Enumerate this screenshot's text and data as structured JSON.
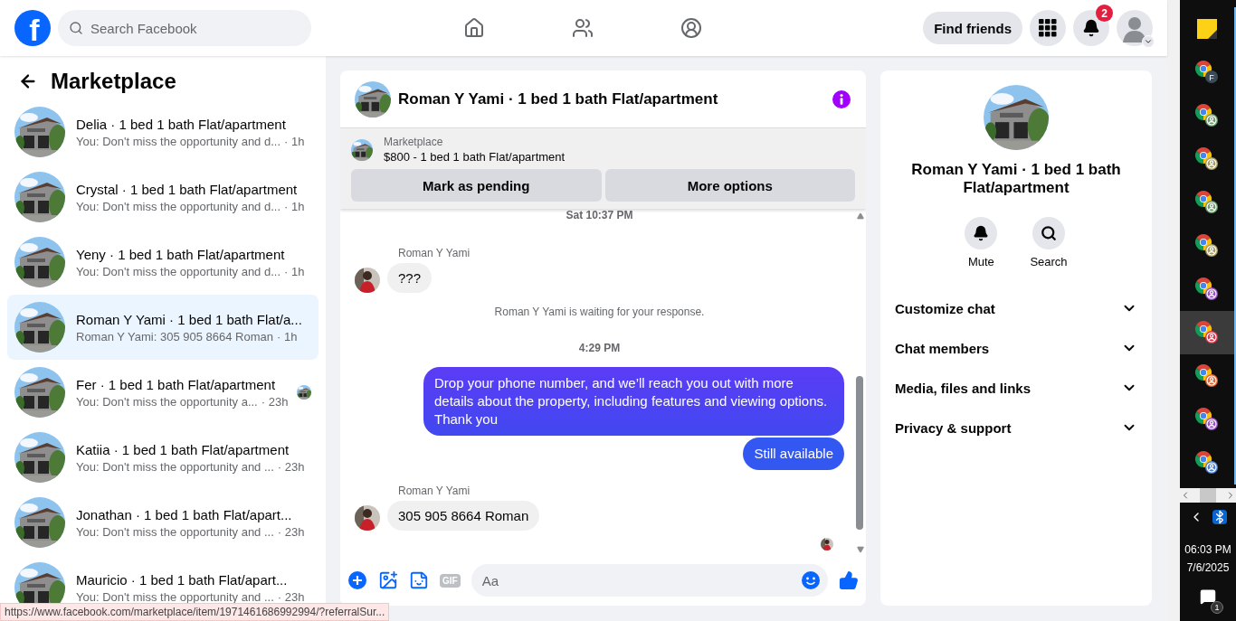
{
  "topbar": {
    "logo": "f",
    "search": {
      "placeholder": "Search Facebook"
    },
    "nav": [
      {
        "kind": "home",
        "selected": false
      },
      {
        "kind": "friends",
        "selected": false
      },
      {
        "kind": "groups",
        "selected": false
      }
    ],
    "find_friends": "Find friends",
    "notifications": {
      "count": "2"
    }
  },
  "sidebar": {
    "title": "Marketplace",
    "conversations": [
      {
        "title": "Delia · 1 bed 1 bath Flat/apartment",
        "preview": "You: Don't miss the opportunity and d...",
        "time": "· 1h",
        "selected": false,
        "read_receipt": false
      },
      {
        "title": "Crystal · 1 bed 1 bath Flat/apartment",
        "preview": "You: Don't miss the opportunity and d...",
        "time": "· 1h",
        "selected": false,
        "read_receipt": false
      },
      {
        "title": "Yeny · 1 bed 1 bath Flat/apartment",
        "preview": "You: Don't miss the opportunity and d...",
        "time": "· 1h",
        "selected": false,
        "read_receipt": false
      },
      {
        "title": "Roman Y Yami · 1 bed 1 bath Flat/a...",
        "preview": "Roman Y Yami: 305 905 8664 Roman",
        "time": "· 1h",
        "selected": true,
        "read_receipt": false
      },
      {
        "title": "Fer · 1 bed 1 bath Flat/apartment",
        "preview": "You: Don't miss the opportunity a...",
        "time": "· 23h",
        "selected": false,
        "read_receipt": true
      },
      {
        "title": "Katiia · 1 bed 1 bath Flat/apartment",
        "preview": "You: Don't miss the opportunity and ...",
        "time": "· 23h",
        "selected": false,
        "read_receipt": false
      },
      {
        "title": "Jonathan · 1 bed 1 bath Flat/apart...",
        "preview": "You: Don't miss the opportunity and ...",
        "time": "· 23h",
        "selected": false,
        "read_receipt": false
      },
      {
        "title": "Mauricio · 1 bed 1 bath Flat/apart...",
        "preview": "You: Don't miss the opportunity and ...",
        "time": "· 23h",
        "selected": false,
        "read_receipt": false
      }
    ]
  },
  "chat": {
    "title": "Roman Y Yami · 1 bed 1 bath Flat/apartment",
    "listing": {
      "source": "Marketplace",
      "summary": "$800 - 1 bed 1 bath Flat/apartment"
    },
    "buttons": [
      "Mark as pending",
      "More options"
    ],
    "messages": [
      {
        "kind": "time",
        "text": "Sat 10:37 PM"
      },
      {
        "kind": "sender",
        "text": "Roman Y Yami"
      },
      {
        "kind": "incoming",
        "text": "???"
      },
      {
        "kind": "notice",
        "text": "Roman Y Yami is waiting for your response."
      },
      {
        "kind": "time",
        "text": "4:29 PM"
      },
      {
        "kind": "outgoing",
        "text": "Drop your phone number, and we’ll reach you out with more details about the property, including features and viewing options. Thank you"
      },
      {
        "kind": "outgoing",
        "text": "Still available"
      },
      {
        "kind": "sender",
        "text": "Roman Y Yami"
      },
      {
        "kind": "incoming",
        "text": "305 905 8664 Roman"
      },
      {
        "kind": "seen"
      }
    ],
    "composer": {
      "gif": "GIF",
      "placeholder": "Aa"
    }
  },
  "details": {
    "title": "Roman Y Yami · 1 bed 1 bath Flat/apartment",
    "actions": [
      {
        "kind": "mute",
        "label": "Mute"
      },
      {
        "kind": "search",
        "label": "Search"
      }
    ],
    "sections": [
      {
        "label": "Customize chat",
        "expanded": false
      },
      {
        "label": "Chat members",
        "expanded": false
      },
      {
        "label": "Media, files and links",
        "expanded": false
      },
      {
        "label": "Privacy & support",
        "expanded": false
      }
    ]
  },
  "status_url": "https://www.facebook.com/marketplace/item/1971461686992994/?referralSur...",
  "taskbar": {
    "apps": [
      {
        "kind": "notes",
        "selected": false
      },
      {
        "kind": "browser",
        "color": "#3b4a57",
        "badge": "F",
        "selected": false
      },
      {
        "kind": "browser",
        "color": "#6a9a6a",
        "selected": false
      },
      {
        "kind": "browser",
        "color": "#a89a5e",
        "selected": false
      },
      {
        "kind": "browser",
        "color": "#6a9a6a",
        "selected": false
      },
      {
        "kind": "browser",
        "color": "#a89a5e",
        "selected": false
      },
      {
        "kind": "browser",
        "color": "#9b4fc8",
        "selected": false
      },
      {
        "kind": "browser",
        "color": "#e0334a",
        "selected": true
      },
      {
        "kind": "browser",
        "color": "#e8632c",
        "selected": false
      },
      {
        "kind": "browser",
        "color": "#9b4fc8",
        "selected": false
      },
      {
        "kind": "browser",
        "color": "#4a7fd6",
        "selected": false
      }
    ],
    "time": "06:03 PM",
    "date": "7/6/2025",
    "notifications": "1"
  }
}
